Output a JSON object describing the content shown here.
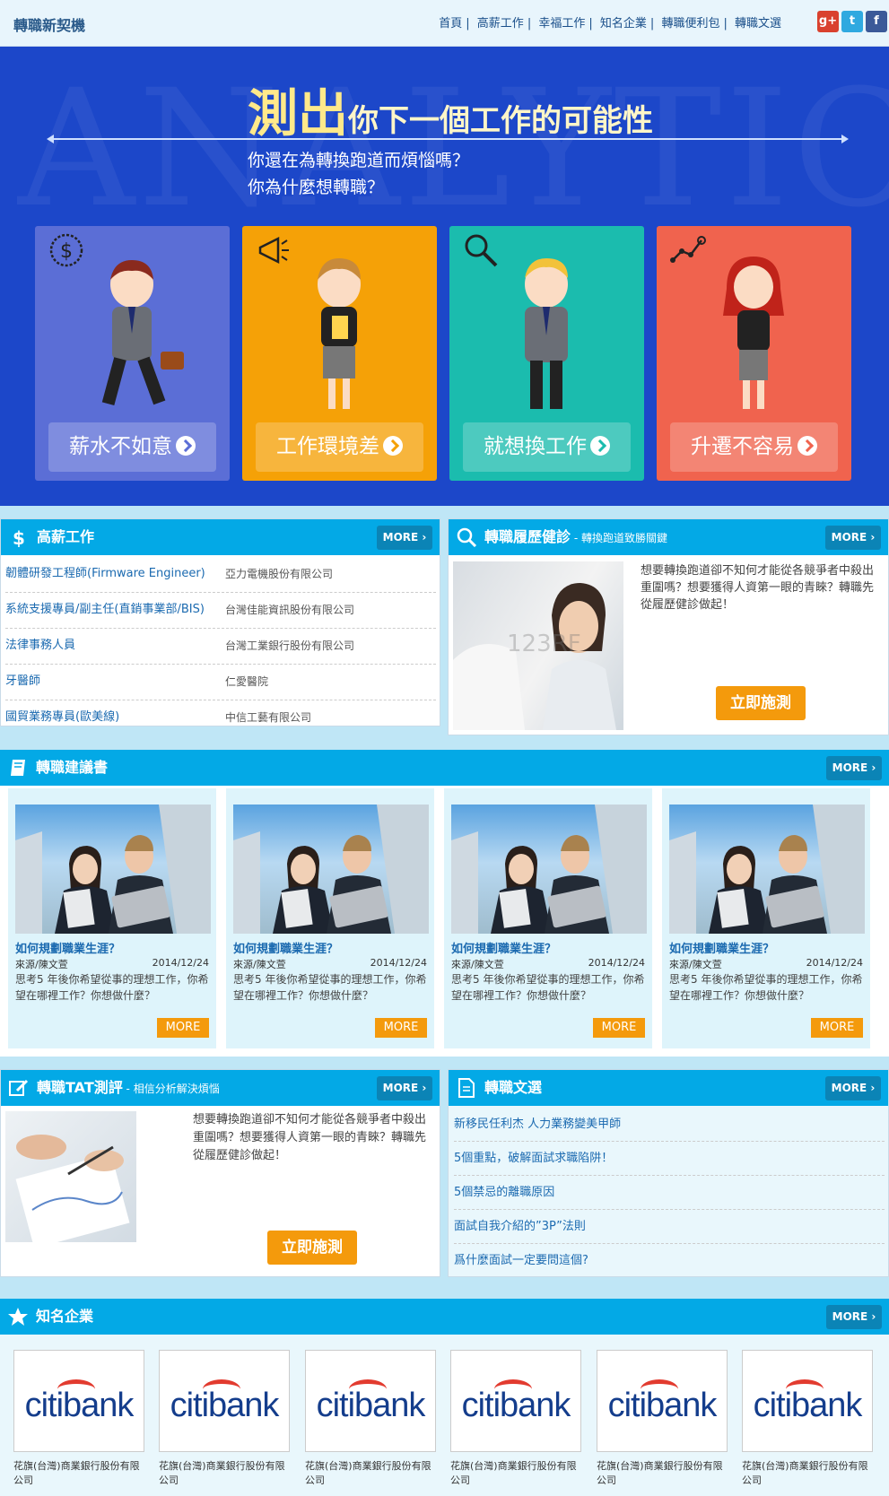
{
  "site": {
    "logo": "轉職新契機"
  },
  "nav": {
    "items": [
      "首頁",
      "高薪工作",
      "幸福工作",
      "知名企業",
      "轉職便利包",
      "轉職文選"
    ],
    "separator": "|"
  },
  "social": {
    "gplus": "g+",
    "twitter": "t",
    "facebook": "f"
  },
  "hero": {
    "bg_text": "ANALYTICS",
    "title_big": "測出",
    "title_rest": "你下一個工作的可能性",
    "sub1": "你還在為轉換跑道而煩惱嗎？",
    "sub2": "你為什麼想轉職？",
    "cards": [
      {
        "label": "薪水不如意",
        "color": "#5b6ed6",
        "icon": "dollar-icon"
      },
      {
        "label": "工作環境差",
        "color": "#f5a107",
        "icon": "megaphone-icon"
      },
      {
        "label": "就想換工作",
        "color": "#1bbcae",
        "icon": "magnifier-icon"
      },
      {
        "label": "升遷不容易",
        "color": "#f0634e",
        "icon": "growth-chart-icon"
      }
    ]
  },
  "jobs": {
    "title": "高薪工作",
    "more": "MORE",
    "rows": [
      {
        "title": "韌體研發工程師(Firmware Engineer)",
        "company": "亞力電機股份有限公司"
      },
      {
        "title": "系統支援專員/副主任(直銷事業部/BIS)",
        "company": "台灣佳能資訊股份有限公司"
      },
      {
        "title": "法律事務人員",
        "company": "台灣工業銀行股份有限公司"
      },
      {
        "title": "牙醫師",
        "company": "仁愛醫院"
      },
      {
        "title": "國貿業務專員(歐美線)",
        "company": "中信工藝有限公司"
      }
    ]
  },
  "resume": {
    "title": "轉職履歷健診",
    "subtitle": " - 轉換跑道致勝關鍵",
    "more": "MORE",
    "text": "想要轉換跑道卻不知何才能從各競爭者中殺出重圍嗎？想要獲得人資第一眼的青睞？轉職先從履歷健診做起！",
    "button": "立即施測",
    "watermark": "123RF"
  },
  "advice": {
    "title": "轉職建議書",
    "more": "MORE",
    "articles": [
      {
        "title": "如何規劃職業生涯？",
        "source": "來源/陳文萱",
        "date": "2014/12/24",
        "text": "思考5 年後你希望從事的理想工作，你希望在哪裡工作？你想做什麼？",
        "more": "MORE"
      },
      {
        "title": "如何規劃職業生涯？",
        "source": "來源/陳文萱",
        "date": "2014/12/24",
        "text": "思考5 年後你希望從事的理想工作，你希望在哪裡工作？你想做什麼？",
        "more": "MORE"
      },
      {
        "title": "如何規劃職業生涯？",
        "source": "來源/陳文萱",
        "date": "2014/12/24",
        "text": "思考5 年後你希望從事的理想工作，你希望在哪裡工作？你想做什麼？",
        "more": "MORE"
      },
      {
        "title": "如何規劃職業生涯？",
        "source": "來源/陳文萱",
        "date": "2014/12/24",
        "text": "思考5 年後你希望從事的理想工作，你希望在哪裡工作？你想做什麼？",
        "more": "MORE"
      }
    ]
  },
  "tat": {
    "title": "轉職TAT測評",
    "subtitle": " - 相信分析解決煩惱",
    "more": "MORE",
    "text": "想要轉換跑道卻不知何才能從各競爭者中殺出重圍嗎？想要獲得人資第一眼的青睞？轉職先從履歷健診做起！",
    "button": "立即施測"
  },
  "articles": {
    "title": "轉職文選",
    "more": "MORE",
    "items": [
      "新移民任利杰 人力業務變美甲師",
      "5個重點，破解面試求職陷阱！",
      "5個禁忌的離職原因",
      "面試自我介紹的”3P”法則",
      "爲什麼面試一定要問這個?"
    ]
  },
  "companies": {
    "title": "知名企業",
    "more": "MORE",
    "logo_text": "citibank",
    "items": [
      "花旗(台灣)商業銀行股份有限公司",
      "花旗(台灣)商業銀行股份有限公司",
      "花旗(台灣)商業銀行股份有限公司",
      "花旗(台灣)商業銀行股份有限公司",
      "花旗(台灣)商業銀行股份有限公司",
      "花旗(台灣)商業銀行股份有限公司"
    ]
  },
  "colors": {
    "header_blue": "#03a9e6",
    "hero_blue": "#1c47c9",
    "orange": "#f49a0c",
    "link": "#1b6ab0"
  }
}
